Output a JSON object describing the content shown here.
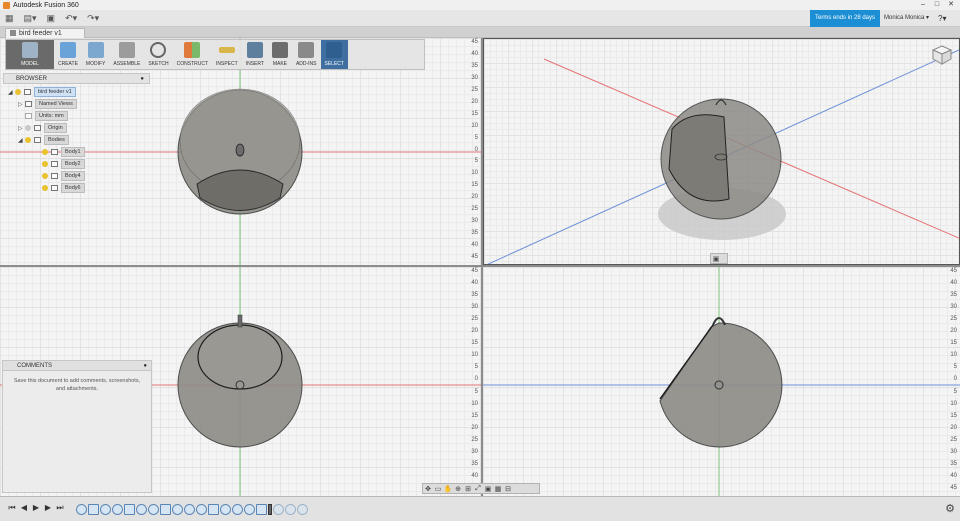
{
  "window": {
    "title": "Autodesk Fusion 360"
  },
  "quick_access": {
    "trial_label": "Terms ends in 28 days",
    "user_label": "Monica Monica",
    "help_label": "?"
  },
  "document": {
    "tab_label": "bird feeder v1"
  },
  "ribbon": {
    "workspace_label": "MODEL",
    "groups": [
      {
        "label": "CREATE",
        "icon": "box-icon"
      },
      {
        "label": "MODIFY",
        "icon": "modify-icon"
      },
      {
        "label": "ASSEMBLE",
        "icon": "assemble-icon"
      },
      {
        "label": "SKETCH",
        "icon": "sketch-icon"
      },
      {
        "label": "CONSTRUCT",
        "icon": "plane-icon"
      },
      {
        "label": "INSPECT",
        "icon": "measure-icon"
      },
      {
        "label": "INSERT",
        "icon": "image-icon"
      },
      {
        "label": "MAKE",
        "icon": "print-icon"
      },
      {
        "label": "ADD-INS",
        "icon": "addins-icon"
      },
      {
        "label": "SELECT",
        "icon": "cursor-icon"
      }
    ]
  },
  "browser": {
    "title": "BROWSER",
    "root": "bird feeder v1",
    "items": [
      "Named Views",
      "Units: mm",
      "Origin",
      "Bodies"
    ],
    "bodies": [
      "Body1",
      "Body2",
      "Body4",
      "Body6"
    ]
  },
  "comments": {
    "title": "COMMENTS",
    "message": "Save this document to add comments, screenshots, and attachments."
  },
  "ruler": {
    "ticks": [
      "45",
      "40",
      "35",
      "30",
      "25",
      "20",
      "15",
      "10",
      "5",
      "0",
      "5",
      "10",
      "15",
      "20",
      "25",
      "30",
      "35",
      "40",
      "45"
    ]
  },
  "colors": {
    "trial": "#1b8ed4",
    "select_group": "#3e6fa0",
    "axis_red": "#e57373",
    "axis_green": "#7cc47c",
    "axis_blue": "#6d8fd8"
  }
}
